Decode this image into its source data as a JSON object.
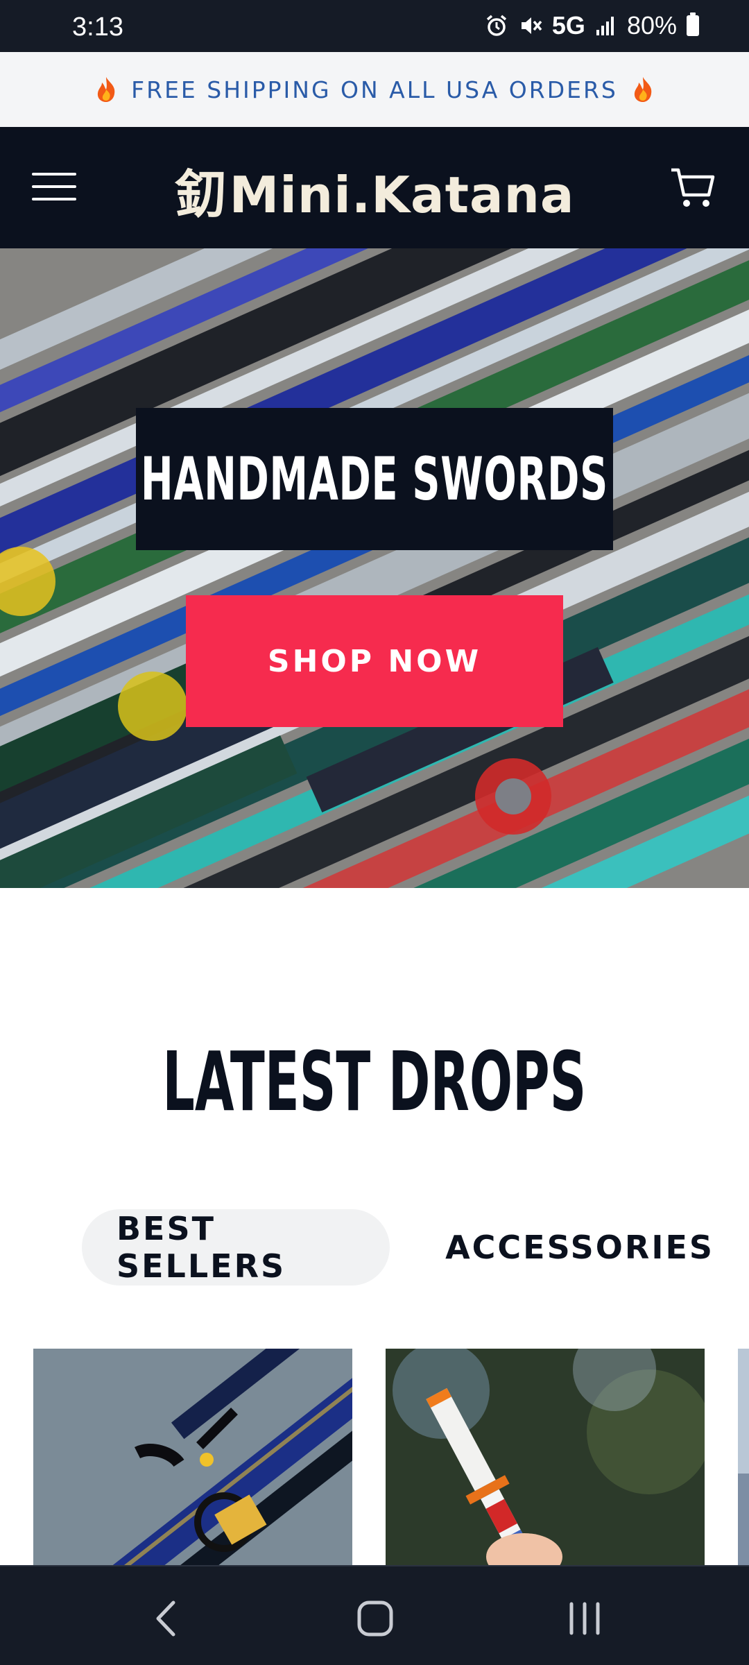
{
  "status_bar": {
    "time": "3:13",
    "network": "5G",
    "battery": "80%",
    "icons": [
      "alarm-icon",
      "mute-icon",
      "signal-icon",
      "battery-icon"
    ]
  },
  "announcement": {
    "text": "FREE SHIPPING ON ALL USA ORDERS",
    "icon": "fire-icon",
    "color": "#2a5ba8"
  },
  "header": {
    "logo_glyph": "釖",
    "logo_text": "Mini.Katana",
    "menu_icon": "hamburger-icon",
    "cart_icon": "cart-icon",
    "background": "#0b111e"
  },
  "hero": {
    "title": "HANDMADE SWORDS",
    "cta_label": "SHOP NOW",
    "cta_color": "#f62b4e"
  },
  "latest": {
    "title": "LATEST DROPS",
    "tabs": [
      {
        "label": "BEST SELLERS",
        "active": true
      },
      {
        "label": "ACCESSORIES",
        "active": false
      }
    ]
  },
  "products": [
    {
      "image": "blue-katana-product-image"
    },
    {
      "image": "orange-white-katana-product-image"
    }
  ],
  "nav_bar": {
    "buttons": [
      "back-icon",
      "home-icon",
      "recents-icon"
    ]
  }
}
